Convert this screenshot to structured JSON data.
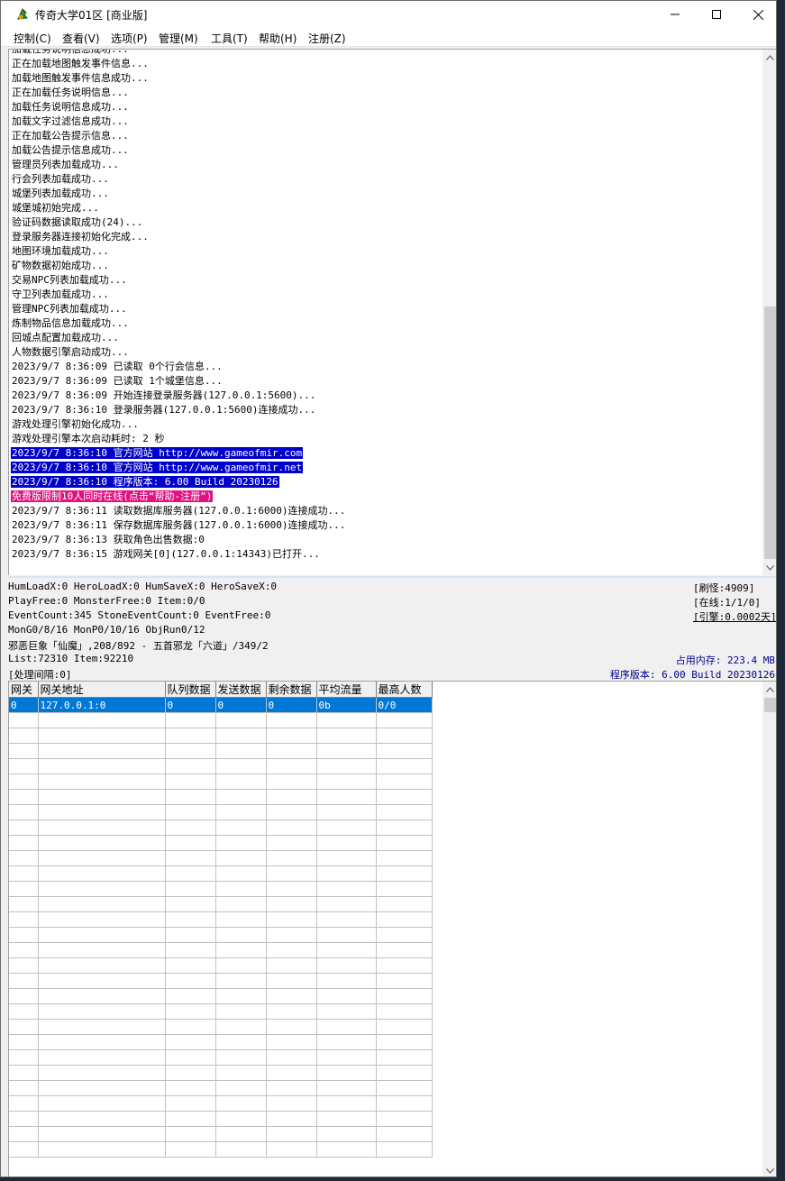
{
  "window": {
    "title": "传奇大学01区 [商业版]",
    "controls": {
      "minimize": "—",
      "maximize": "☐",
      "close": "✕"
    }
  },
  "menu": [
    "控制(C)",
    "查看(V)",
    "选项(P)",
    "管理(M)",
    "工具(T)",
    "帮助(H)",
    "注册(Z)"
  ],
  "log": {
    "lines": [
      {
        "text": "加载任务说明信息成功...",
        "style": "normal"
      },
      {
        "text": "正在加载地图触发事件信息...",
        "style": "normal"
      },
      {
        "text": "加载地图触发事件信息成功...",
        "style": "normal"
      },
      {
        "text": "正在加载任务说明信息...",
        "style": "normal"
      },
      {
        "text": "加载任务说明信息成功...",
        "style": "normal"
      },
      {
        "text": "加载文字过滤信息成功...",
        "style": "normal"
      },
      {
        "text": "正在加载公告提示信息...",
        "style": "normal"
      },
      {
        "text": "加载公告提示信息成功...",
        "style": "normal"
      },
      {
        "text": "管理员列表加载成功...",
        "style": "normal"
      },
      {
        "text": "行会列表加载成功...",
        "style": "normal"
      },
      {
        "text": "城堡列表加载成功...",
        "style": "normal"
      },
      {
        "text": "城堡城初始完成...",
        "style": "normal"
      },
      {
        "text": "验证码数据读取成功(24)...",
        "style": "normal"
      },
      {
        "text": "登录服务器连接初始化完成...",
        "style": "normal"
      },
      {
        "text": "地图环境加载成功...",
        "style": "normal"
      },
      {
        "text": "矿物数据初始成功...",
        "style": "normal"
      },
      {
        "text": "交易NPC列表加载成功...",
        "style": "normal"
      },
      {
        "text": "守卫列表加载成功...",
        "style": "normal"
      },
      {
        "text": "管理NPC列表加载成功...",
        "style": "normal"
      },
      {
        "text": "炼制物品信息加载成功...",
        "style": "normal"
      },
      {
        "text": "回城点配置加载成功...",
        "style": "normal"
      },
      {
        "text": "人物数据引擎启动成功...",
        "style": "normal"
      },
      {
        "text": "2023/9/7 8:36:09 已读取 0个行会信息...",
        "style": "normal"
      },
      {
        "text": "2023/9/7 8:36:09 已读取 1个城堡信息...",
        "style": "normal"
      },
      {
        "text": "2023/9/7 8:36:09 开始连接登录服务器(127.0.0.1:5600)...",
        "style": "normal"
      },
      {
        "text": "2023/9/7 8:36:10 登录服务器(127.0.0.1:5600)连接成功...",
        "style": "normal"
      },
      {
        "text": "游戏处理引擎初始化成功...",
        "style": "normal"
      },
      {
        "text": "游戏处理引擎本次启动耗时: 2 秒",
        "style": "normal"
      },
      {
        "text": "2023/9/7 8:36:10 官方网站 http://www.gameofmir.com",
        "style": "blue"
      },
      {
        "text": "2023/9/7 8:36:10 官方网站 http://www.gameofmir.net",
        "style": "blue"
      },
      {
        "text": "2023/9/7 8:36:10 程序版本: 6.00 Build 20230126",
        "style": "blue"
      },
      {
        "text": "免费版限制10人同时在线(点击“帮助-注册”)",
        "style": "pink"
      },
      {
        "text": "2023/9/7 8:36:11 读取数据库服务器(127.0.0.1:6000)连接成功...",
        "style": "normal"
      },
      {
        "text": "2023/9/7 8:36:11 保存数据库服务器(127.0.0.1:6000)连接成功...",
        "style": "normal"
      },
      {
        "text": "2023/9/7 8:36:13 获取角色出售数据:0",
        "style": "normal"
      },
      {
        "text": "2023/9/7 8:36:15 游戏网关[0](127.0.0.1:14343)已打开...",
        "style": "normal"
      }
    ]
  },
  "status": {
    "line1": "HumLoadX:0 HeroLoadX:0 HumSaveX:0 HeroSaveX:0",
    "line2": "PlayFree:0 MonsterFree:0 Item:0/0",
    "line3": "EventCount:345 StoneEventCount:0 EventFree:0",
    "line4": "MonG0/8/16 MonP0/10/16 ObjRun0/12",
    "line5": "邪恶巨象「仙魔」,208/892 - 五首邪龙「六道」/349/2",
    "line6": "List:72310 Item:92210",
    "line7": "[处理间隔:0]",
    "refresh_monsters": "[刷怪:4909]",
    "online": "[在线:1/1/0]",
    "engine": "[引擎:0.0002天]",
    "memory": "占用内存: 223.4 MB",
    "version": "程序版本: 6.00 Build 20230126"
  },
  "grid": {
    "columns": [
      "网关",
      "网关地址",
      "队列数据",
      "发送数据",
      "剩余数据",
      "平均流量",
      "最高人数"
    ],
    "rows": [
      [
        "0",
        "127.0.0.1:0",
        "0",
        "0",
        "0",
        "0b",
        "0/0"
      ]
    ]
  }
}
